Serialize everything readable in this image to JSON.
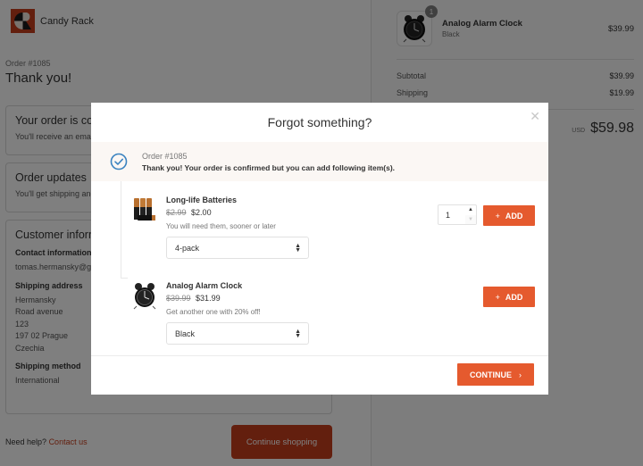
{
  "store": {
    "name": "Candy Rack",
    "brand_color": "#c73e1d"
  },
  "main": {
    "order_number": "Order #1085",
    "title": "Thank you!",
    "confirmed_box": {
      "title": "Your order is confirmed",
      "text": "You'll receive an email when your order is ready."
    },
    "updates_box": {
      "title": "Order updates",
      "text": "You'll get shipping and delivery updates by email."
    },
    "customer_box": {
      "title": "Customer information",
      "contact_label": "Contact information",
      "contact_value": "tomas.hermansky@gmail.com",
      "shipping_label": "Shipping address",
      "address": [
        "Hermansky",
        "Road avenue",
        "123",
        "197 02 Prague",
        "Czechia"
      ],
      "method_label": "Shipping method",
      "method_value": "International"
    },
    "help_text": "Need help?",
    "help_link": "Contact us",
    "continue_shopping": "Continue shopping"
  },
  "summary": {
    "item": {
      "name": "Analog Alarm Clock",
      "variant": "Black",
      "price": "$39.99",
      "quantity": "1"
    },
    "subtotal_label": "Subtotal",
    "subtotal_value": "$39.99",
    "shipping_label": "Shipping",
    "shipping_value": "$19.99",
    "currency": "USD",
    "total": "$59.98"
  },
  "modal": {
    "title": "Forgot something?",
    "close_icon": "close-icon",
    "notice": {
      "order": "Order #1085",
      "message": "Thank you! Your order is confirmed but you can add following item(s)."
    },
    "items": [
      {
        "name": "Long-life Batteries",
        "old_price": "$2.99",
        "price": "$2.00",
        "description": "You will need them, sooner or later",
        "option": "4-pack",
        "quantity": "1",
        "add_label": "ADD"
      },
      {
        "name": "Analog Alarm Clock",
        "old_price": "$39.99",
        "price": "$31.99",
        "description": "Get another one with 20% off!",
        "option": "Black",
        "add_label": "ADD"
      }
    ],
    "continue_label": "CONTINUE",
    "accent_color": "#e55a2e"
  }
}
